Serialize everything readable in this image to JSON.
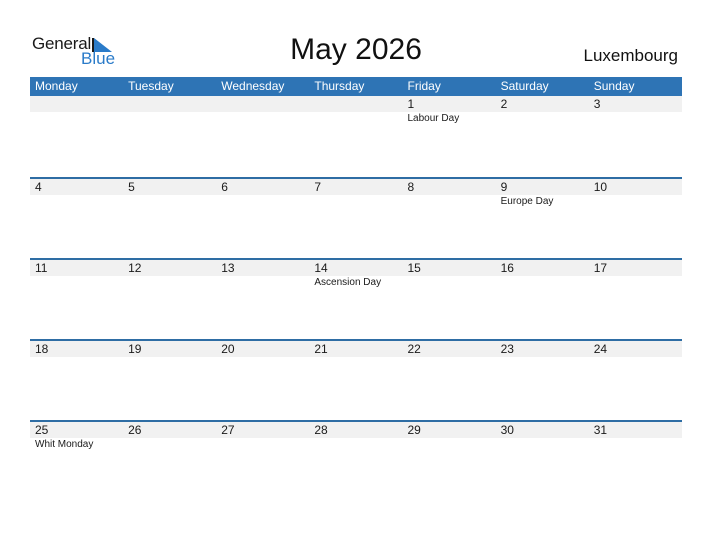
{
  "logo": {
    "general": "General",
    "blue": "Blue",
    "accent_color": "#2a7bc9"
  },
  "title": "May 2026",
  "country": "Luxembourg",
  "header_color": "#2e74b5",
  "days": [
    "Monday",
    "Tuesday",
    "Wednesday",
    "Thursday",
    "Friday",
    "Saturday",
    "Sunday"
  ],
  "weeks": [
    [
      {
        "d": "",
        "h": ""
      },
      {
        "d": "",
        "h": ""
      },
      {
        "d": "",
        "h": ""
      },
      {
        "d": "",
        "h": ""
      },
      {
        "d": "1",
        "h": "Labour Day"
      },
      {
        "d": "2",
        "h": ""
      },
      {
        "d": "3",
        "h": ""
      }
    ],
    [
      {
        "d": "4",
        "h": ""
      },
      {
        "d": "5",
        "h": ""
      },
      {
        "d": "6",
        "h": ""
      },
      {
        "d": "7",
        "h": ""
      },
      {
        "d": "8",
        "h": ""
      },
      {
        "d": "9",
        "h": "Europe Day"
      },
      {
        "d": "10",
        "h": ""
      }
    ],
    [
      {
        "d": "11",
        "h": ""
      },
      {
        "d": "12",
        "h": ""
      },
      {
        "d": "13",
        "h": ""
      },
      {
        "d": "14",
        "h": "Ascension Day"
      },
      {
        "d": "15",
        "h": ""
      },
      {
        "d": "16",
        "h": ""
      },
      {
        "d": "17",
        "h": ""
      }
    ],
    [
      {
        "d": "18",
        "h": ""
      },
      {
        "d": "19",
        "h": ""
      },
      {
        "d": "20",
        "h": ""
      },
      {
        "d": "21",
        "h": ""
      },
      {
        "d": "22",
        "h": ""
      },
      {
        "d": "23",
        "h": ""
      },
      {
        "d": "24",
        "h": ""
      }
    ],
    [
      {
        "d": "25",
        "h": "Whit Monday"
      },
      {
        "d": "26",
        "h": ""
      },
      {
        "d": "27",
        "h": ""
      },
      {
        "d": "28",
        "h": ""
      },
      {
        "d": "29",
        "h": ""
      },
      {
        "d": "30",
        "h": ""
      },
      {
        "d": "31",
        "h": ""
      }
    ]
  ]
}
